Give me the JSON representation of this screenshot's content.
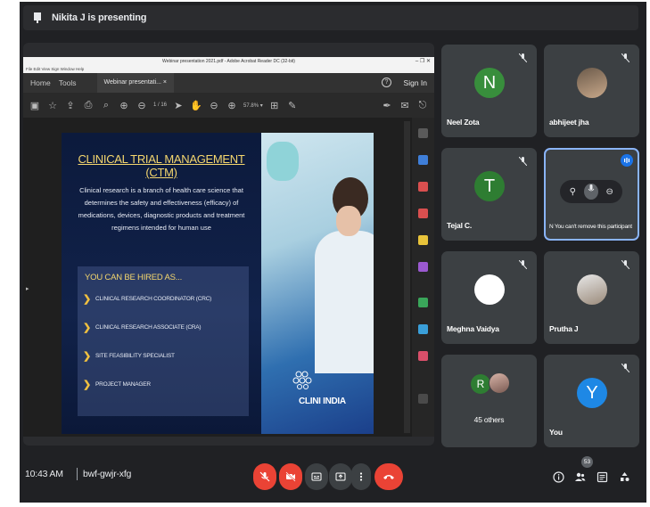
{
  "present_bar": {
    "text": "Nikita J is presenting",
    "icon": "presentation-icon"
  },
  "acrobat": {
    "window_title": "Webinar presentation 2021.pdf - Adobe Acrobat Reader DC (32-bit)",
    "window_buttons": "– ❐ ✕",
    "menu": "File  Edit  View  Sign  Window  Help",
    "tabs": {
      "home": "Home",
      "tools": "Tools",
      "doc": "Webinar presentati...  ×"
    },
    "help": "?",
    "sign_in": "Sign In",
    "page_indicator": "1 / 16",
    "zoom": "57.8%  ▾"
  },
  "slide": {
    "title": "CLINICAL TRIAL MANAGEMENT (CTM)",
    "paragraph": "Clinical research is a branch of health care science that determines the safety and effectiveness  (efficacy) of medications, devices, diagnostic products and treatment regimens intended for human use",
    "hire_title": "YOU CAN BE HIRED AS...",
    "roles": [
      "CLINICAL RESEARCH COORDINATOR (CRC)",
      "CLINICAL RESEARCH ASSOCIATE (CRA)",
      "SITE FEASIBILITY SPECIALIST",
      "PROJECT MANAGER"
    ],
    "logo_text": "CLINI INDIA"
  },
  "participants": {
    "neel": {
      "initial": "N",
      "name": "Neel Zota",
      "color": "#388e3c"
    },
    "abhijeet": {
      "name": "abhijeet jha"
    },
    "tejal": {
      "initial": "T",
      "name": "Tejal C.",
      "color": "#2e7d32"
    },
    "pinned": {
      "message": "You can't remove this participant",
      "prefix": "N"
    },
    "meghna": {
      "name": "Meghna Vaidya"
    },
    "prutha": {
      "name": "Prutha J"
    },
    "others": {
      "initial": "R",
      "label": "45 others"
    },
    "you": {
      "initial": "Y",
      "name": "You",
      "color": "#1e88e5"
    }
  },
  "bottom": {
    "time": "10:43 AM",
    "code": "bwf-gwjr-xfg",
    "people_count": "53"
  },
  "colors": {
    "end_call": "#ea4335",
    "mic_off": "#ea4335",
    "background": "#202124",
    "tile": "#3c4043"
  }
}
